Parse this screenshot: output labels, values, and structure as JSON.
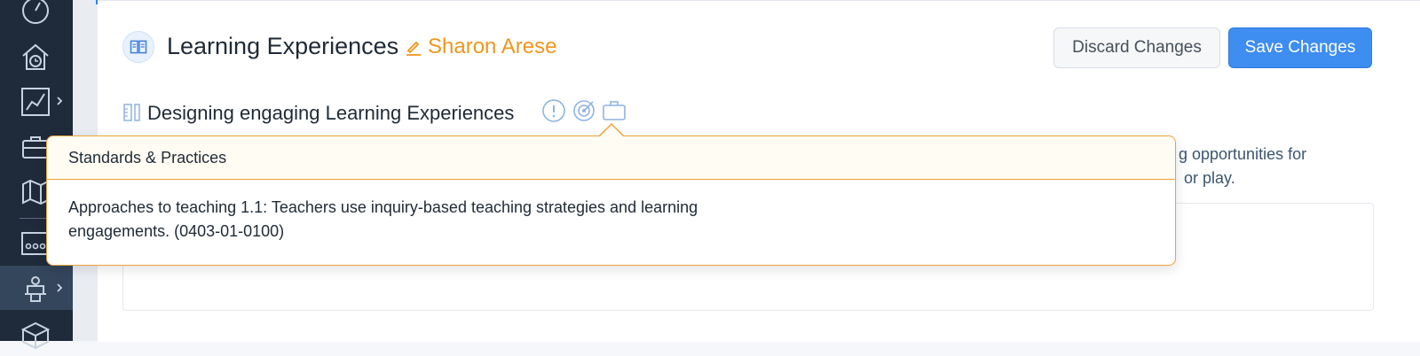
{
  "colors": {
    "sidebar_bg": "#1f2a3b",
    "accent_orange": "#f0961e",
    "primary_blue": "#3e8df0",
    "popover_border": "#f0a23a"
  },
  "sidebar": {
    "items": [
      {
        "icon": "gauge-icon"
      },
      {
        "icon": "home-clock-icon"
      },
      {
        "icon": "line-chart-icon",
        "has_chevron": true
      },
      {
        "icon": "briefcase-icon"
      },
      {
        "icon": "map-icon"
      },
      {
        "icon": "classroom-icon"
      },
      {
        "icon": "presenter-icon",
        "has_chevron": true,
        "active": true
      },
      {
        "icon": "cube-icon"
      }
    ]
  },
  "header": {
    "title": "Learning Experiences",
    "author": "Sharon Arese",
    "title_icon": "book-icon",
    "author_icon": "pencil-icon",
    "discard_label": "Discard Changes",
    "save_label": "Save Changes"
  },
  "section": {
    "title": "Designing engaging Learning Experiences",
    "icon": "ruler-pencil-icon",
    "action_icons": [
      "info-circle-icon",
      "target-icon",
      "briefcase-icon"
    ],
    "description_line1": "g opportunities for",
    "description_line2": "or play."
  },
  "popover": {
    "heading": "Standards & Practices",
    "body_line1": "Approaches to teaching 1.1: Teachers use inquiry-based teaching strategies and learning",
    "body_line2": "engagements. (0403-01-0100)"
  }
}
